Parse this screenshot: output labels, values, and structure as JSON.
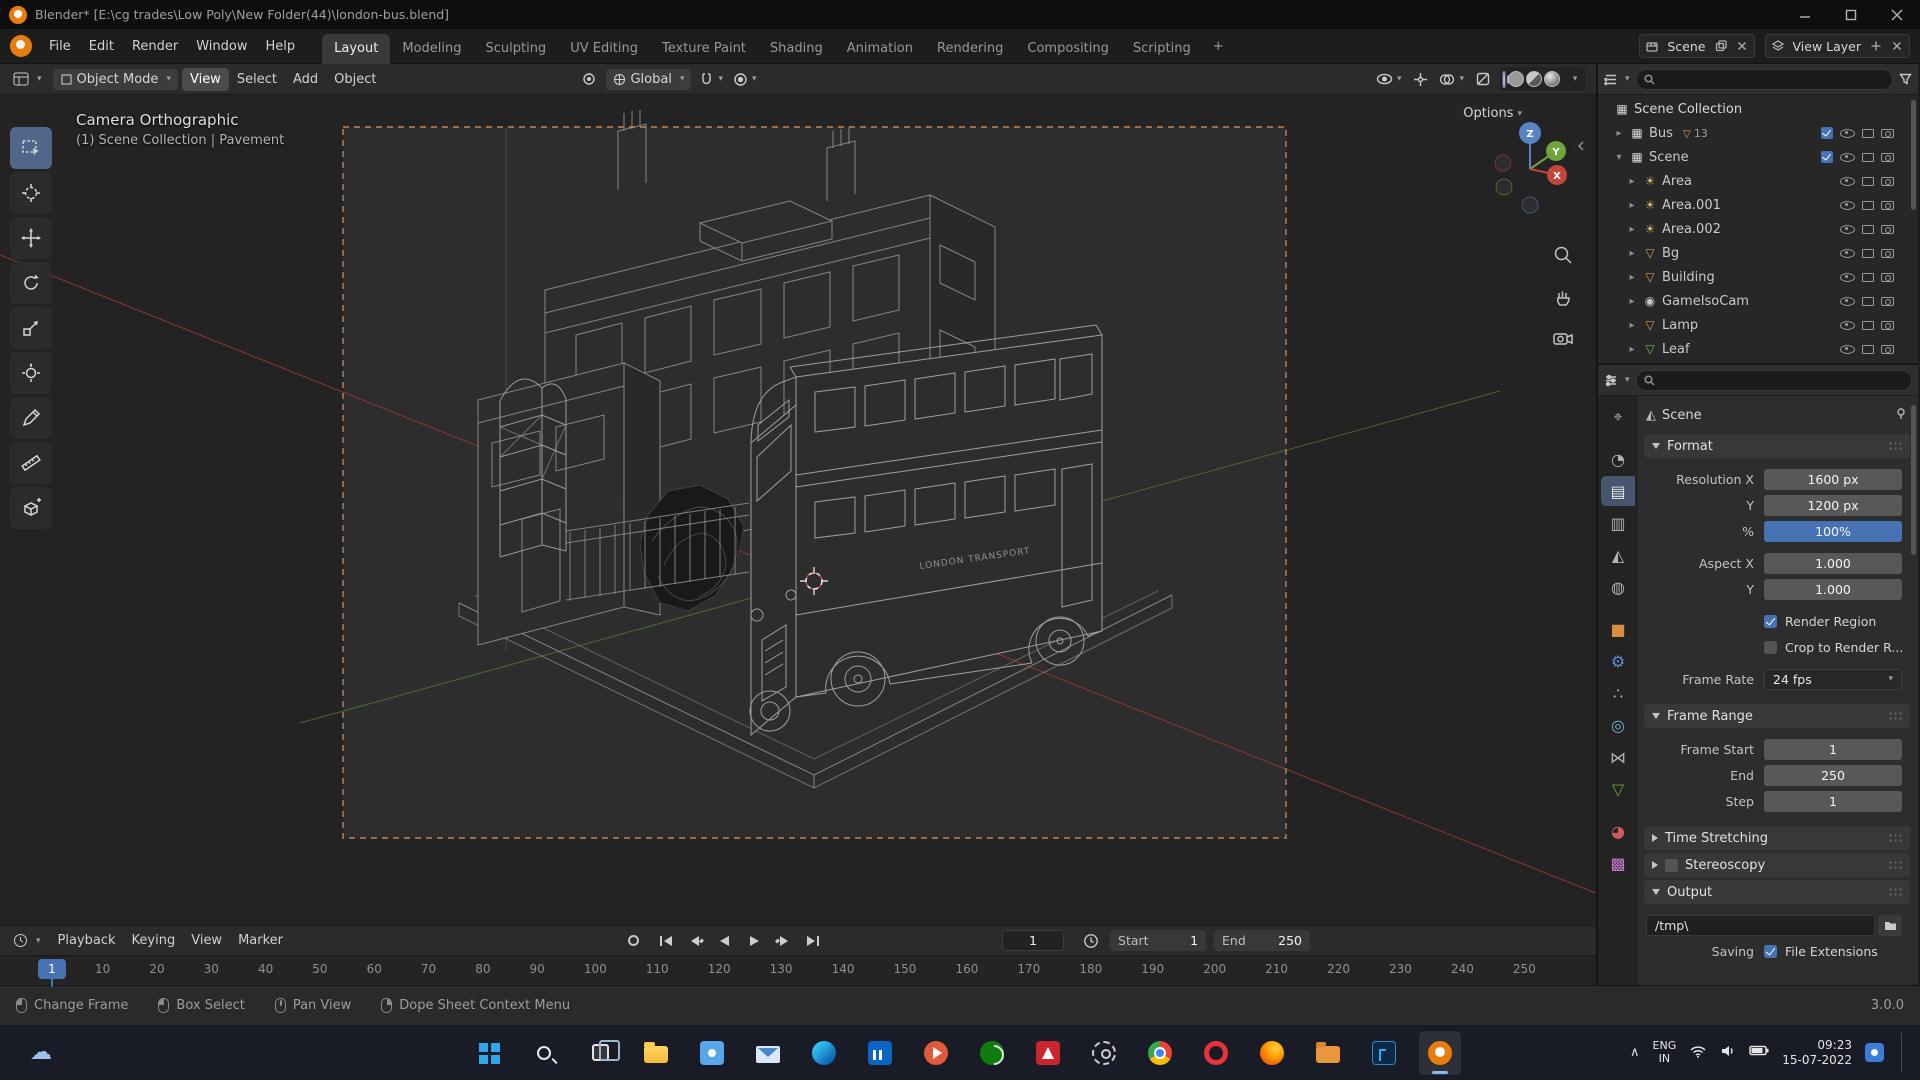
{
  "titlebar": {
    "title": "Blender* [E:\\cg trades\\Low Poly\\New Folder(44)\\london-bus.blend]"
  },
  "topbar": {
    "menus": [
      "File",
      "Edit",
      "Render",
      "Window",
      "Help"
    ],
    "workspaces": [
      {
        "label": "Layout",
        "active": true
      },
      {
        "label": "Modeling"
      },
      {
        "label": "Sculpting"
      },
      {
        "label": "UV Editing"
      },
      {
        "label": "Texture Paint"
      },
      {
        "label": "Shading"
      },
      {
        "label": "Animation"
      },
      {
        "label": "Rendering"
      },
      {
        "label": "Compositing"
      },
      {
        "label": "Scripting"
      }
    ],
    "add_tab": "+",
    "scene_label": "Scene",
    "view_layer_label": "View Layer"
  },
  "tool_header": {
    "mode": "Object Mode",
    "menus": [
      {
        "label": "View",
        "active": true
      },
      {
        "label": "Select"
      },
      {
        "label": "Add"
      },
      {
        "label": "Object"
      }
    ],
    "orientation": "Global",
    "options": "Options"
  },
  "toolbar_tools": [
    "select-box",
    "cursor",
    "move",
    "rotate",
    "scale",
    "transform",
    "annotate",
    "measure",
    "add-cube"
  ],
  "viewport": {
    "camera_label": "Camera Orthographic",
    "context_label": "(1) Scene Collection | Pavement",
    "bus_decal": "LONDON TRANSPORT",
    "gizmo": {
      "x": "X",
      "y": "Y",
      "z": "Z"
    }
  },
  "outliner": {
    "root_label": "Scene Collection",
    "items": [
      {
        "label": "Bus",
        "glyph": "▦",
        "color": "#d8d8d8",
        "arrow": "▸",
        "cls": "col",
        "depth": 1,
        "badge": "13"
      },
      {
        "label": "Scene",
        "glyph": "▦",
        "color": "#d8d8d8",
        "arrow": "▾",
        "cls": "col",
        "depth": 1
      },
      {
        "label": "Area",
        "glyph": "☀",
        "color": "#ddba66",
        "arrow": "▸",
        "cls": "obj",
        "depth": 2
      },
      {
        "label": "Area.001",
        "glyph": "☀",
        "color": "#ddba66",
        "arrow": "▸",
        "cls": "obj",
        "depth": 2
      },
      {
        "label": "Area.002",
        "glyph": "☀",
        "color": "#ddba66",
        "arrow": "▸",
        "cls": "obj",
        "depth": 2
      },
      {
        "label": "Bg",
        "glyph": "▽",
        "color": "#d89c5a",
        "arrow": "▸",
        "cls": "obj",
        "depth": 2
      },
      {
        "label": "Building",
        "glyph": "▽",
        "color": "#d89c5a",
        "arrow": "▸",
        "cls": "obj",
        "depth": 2
      },
      {
        "label": "GameIsoCam",
        "glyph": "◉",
        "color": "#c8c8c8",
        "arrow": "▸",
        "cls": "obj",
        "depth": 2
      },
      {
        "label": "Lamp",
        "glyph": "▽",
        "color": "#d89c5a",
        "arrow": "▸",
        "cls": "obj",
        "depth": 2
      },
      {
        "label": "Leaf",
        "glyph": "▽",
        "color": "#7ab648",
        "arrow": "▸",
        "cls": "obj",
        "depth": 2
      }
    ]
  },
  "properties": {
    "tabs": [
      {
        "name": "tool",
        "glyph": "⌖",
        "color": "#b2b2b2"
      },
      {
        "name": "render",
        "glyph": "◔",
        "color": "#b2b2b2",
        "cls": "gap"
      },
      {
        "name": "output",
        "glyph": "▤",
        "color": "#e8e8e8",
        "active": true
      },
      {
        "name": "view-layer",
        "glyph": "▥",
        "color": "#b2b2b2"
      },
      {
        "name": "scene",
        "glyph": "◭",
        "color": "#b2b2b2"
      },
      {
        "name": "world",
        "glyph": "◍",
        "color": "#b2b2b2"
      },
      {
        "name": "object",
        "glyph": "■",
        "color": "#d98d3e",
        "cls": "gap"
      },
      {
        "name": "modifiers",
        "glyph": "⚙",
        "color": "#5f8fd1"
      },
      {
        "name": "particles",
        "glyph": "∴",
        "color": "#b2b2b2"
      },
      {
        "name": "physics",
        "glyph": "◎",
        "color": "#6fb3d1"
      },
      {
        "name": "constraints",
        "glyph": "⋈",
        "color": "#b2b2b2"
      },
      {
        "name": "object-data",
        "glyph": "▽",
        "color": "#6fa33e"
      },
      {
        "name": "material",
        "glyph": "◕",
        "color": "#c95b5b",
        "cls": "gap"
      },
      {
        "name": "texture",
        "glyph": "▩",
        "color": "#c77ad1"
      }
    ],
    "breadcrumb": {
      "id_label": "Scene",
      "glyph": "◭"
    },
    "format": {
      "title": "Format",
      "resolution_x_label": "Resolution X",
      "resolution_x": "1600 px",
      "resolution_y_label": "Y",
      "resolution_y": "1200 px",
      "percent_label": "%",
      "percent": "100%",
      "aspect_x_label": "Aspect X",
      "aspect_x": "1.000",
      "aspect_y_label": "Y",
      "aspect_y": "1.000",
      "render_region": "Render Region",
      "crop": "Crop to Render R...",
      "frame_rate_label": "Frame Rate",
      "frame_rate": "24 fps"
    },
    "frame_range": {
      "title": "Frame Range",
      "start_label": "Frame Start",
      "start": "1",
      "end_label": "End",
      "end": "250",
      "step_label": "Step",
      "step": "1",
      "time_stretching": "Time Stretching"
    },
    "stereoscopy": {
      "title": "Stereoscopy"
    },
    "output": {
      "title": "Output",
      "path": "/tmp\\",
      "saving_label": "Saving",
      "file_extensions": "File Extensions"
    }
  },
  "timeline": {
    "menus": [
      {
        "label": "Playback",
        "cls": "drop"
      },
      {
        "label": "Keying",
        "cls": "drop"
      },
      {
        "label": "View"
      },
      {
        "label": "Marker"
      }
    ],
    "current_frame": "1",
    "start_label": "Start",
    "start_value": "1",
    "end_label": "End",
    "end_value": "250",
    "ticks": [
      "1",
      "10",
      "20",
      "30",
      "40",
      "50",
      "60",
      "70",
      "80",
      "90",
      "100",
      "110",
      "120",
      "130",
      "140",
      "150",
      "160",
      "170",
      "180",
      "190",
      "200",
      "210",
      "220",
      "230",
      "240",
      "250"
    ]
  },
  "statusbar": {
    "hints": [
      {
        "label": "Change Frame",
        "cls": "lmb"
      },
      {
        "label": "Box Select",
        "cls": "lmb"
      },
      {
        "label": "Pan View",
        "cls": "mmb"
      },
      {
        "label": "Dope Sheet Context Menu",
        "cls": "rmb"
      }
    ],
    "version": "3.0.0"
  },
  "taskbar": {
    "icons": [
      "start",
      "search",
      "task-view",
      "explorer",
      "photos",
      "mail",
      "edge",
      "linkedin",
      "media",
      "xbox",
      "adobe",
      "settings",
      "chrome",
      "opera",
      "firefox",
      "files",
      "photoshop",
      "blender"
    ],
    "active_icon": "blender",
    "lang": "ENG",
    "region": "IN",
    "time": "09:23",
    "date": "15-07-2022"
  }
}
